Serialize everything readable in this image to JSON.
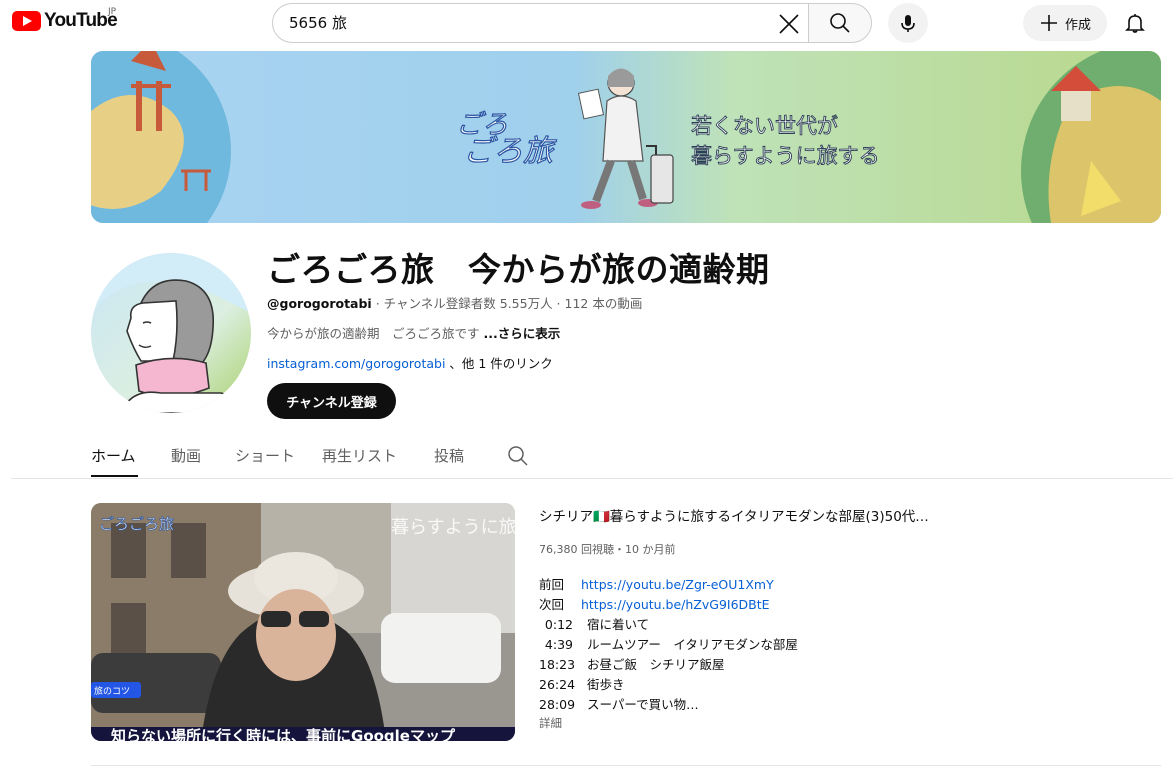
{
  "header": {
    "logo_text": "YouTube",
    "country_code": "JP",
    "search_value": "5656 旅",
    "create_label": "作成"
  },
  "banner": {
    "logo_line1": "ごろ",
    "logo_line2": "ごろ旅",
    "tagline_line1": "若くない世代が",
    "tagline_line2": "暮らすように旅する"
  },
  "channel": {
    "name": "ごろごろ旅　今からが旅の適齢期",
    "handle": "@gorogorotabi",
    "meta": " · チャンネル登録者数 5.55万人 · 112 本の動画",
    "description": "今からが旅の適齢期　ごろごろ旅です ",
    "more_label": "...さらに表示",
    "link_text": "instagram.com/gorogorotabi",
    "link_suffix": " 、他 1 件のリンク",
    "subscribe_label": "チャンネル登録"
  },
  "tabs": [
    {
      "label": "ホーム",
      "active": true
    },
    {
      "label": "動画",
      "active": false
    },
    {
      "label": "ショート",
      "active": false
    },
    {
      "label": "再生リスト",
      "active": false
    },
    {
      "label": "投稿",
      "active": false
    }
  ],
  "video": {
    "title": "シチリア🇮🇹暮らすように旅するイタリアモダンな部屋(3)50代…",
    "meta": "76,380 回視聴・10 か月前",
    "thumb_logo": "ごろごろ旅",
    "thumb_overlay": "暮らすように旅",
    "thumb_tag": "旅のコツ",
    "thumb_caption": "知らない場所に行く時には、事前にGoogleマップ",
    "links": [
      {
        "label": "前回",
        "url": "https://youtu.be/Zgr-eOU1XmY"
      },
      {
        "label": "次回",
        "url": "https://youtu.be/hZvG9I6DBtE"
      }
    ],
    "chapters": [
      {
        "time": "0:12",
        "text": "宿に着いて"
      },
      {
        "time": "4:39",
        "text": "ルームツアー　イタリアモダンな部屋"
      },
      {
        "time": "18:23",
        "text": "お昼ご飯　シチリア飯屋"
      },
      {
        "time": "26:24",
        "text": "街歩き"
      },
      {
        "time": "28:09",
        "text": "スーパーで買い物…"
      }
    ],
    "details_label": "詳細"
  },
  "colors": {
    "brand_red": "#ff0000",
    "link_blue": "#065fd4"
  }
}
